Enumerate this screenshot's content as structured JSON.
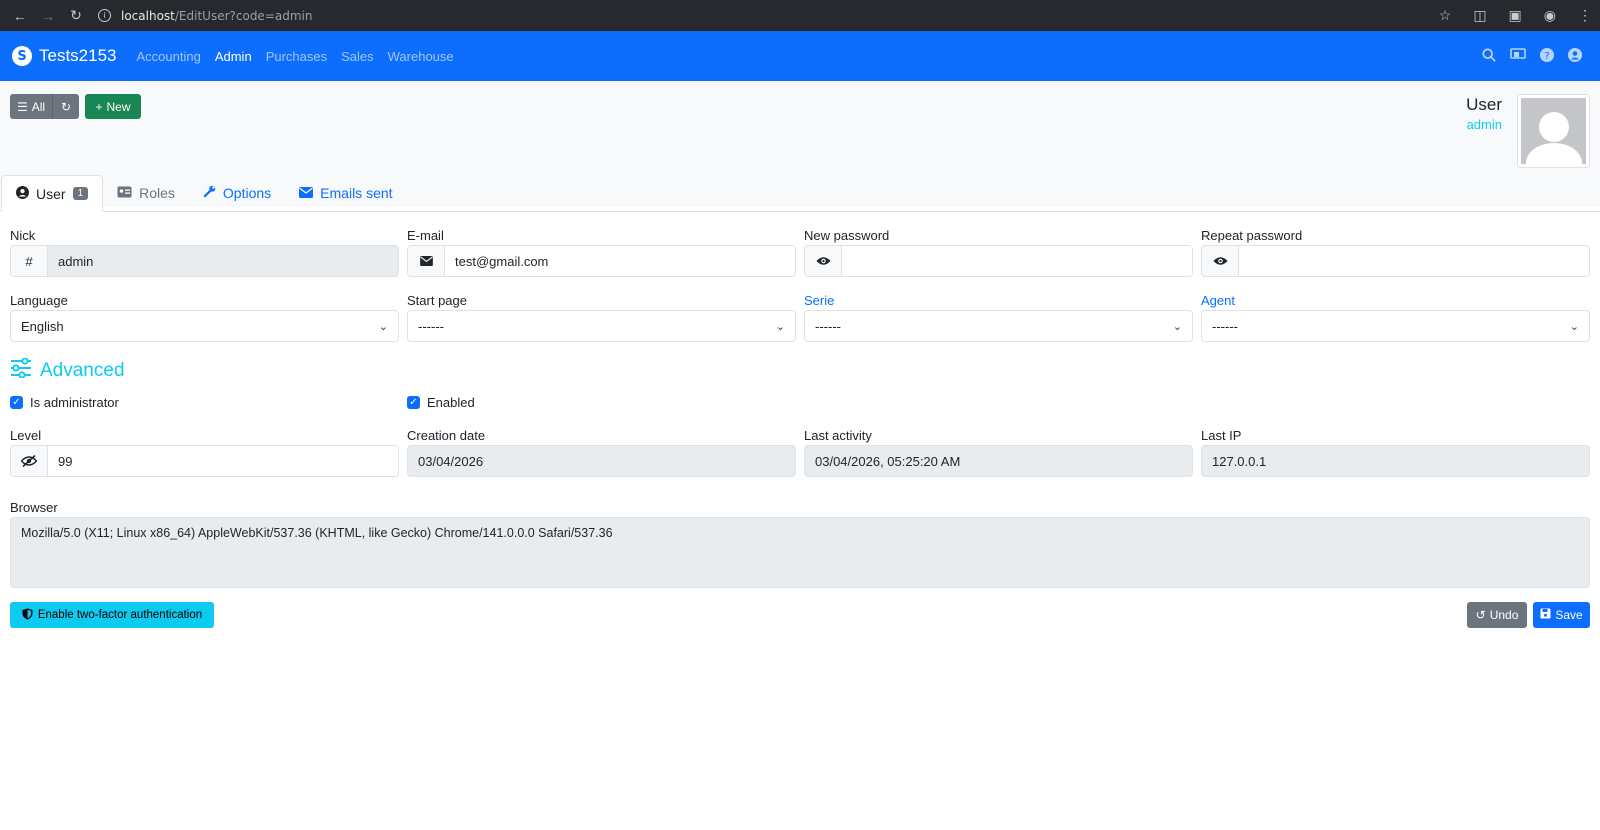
{
  "browser": {
    "url_host": "localhost",
    "url_path": "/EditUser?code=admin"
  },
  "navbar": {
    "brand": "Tests2153",
    "items": [
      {
        "label": "Accounting",
        "active": false
      },
      {
        "label": "Admin",
        "active": true
      },
      {
        "label": "Purchases",
        "active": false
      },
      {
        "label": "Sales",
        "active": false
      },
      {
        "label": "Warehouse",
        "active": false
      }
    ]
  },
  "toolbar": {
    "all_label": "All",
    "new_label": "New"
  },
  "record": {
    "title": "User",
    "subtitle": "admin"
  },
  "tabs": [
    {
      "label": "User",
      "badge": "1"
    },
    {
      "label": "Roles"
    },
    {
      "label": "Options"
    },
    {
      "label": "Emails sent"
    }
  ],
  "form": {
    "nick_label": "Nick",
    "nick_value": "admin",
    "email_label": "E-mail",
    "email_value": "test@gmail.com",
    "new_password_label": "New password",
    "new_password_value": "",
    "repeat_password_label": "Repeat password",
    "repeat_password_value": "",
    "language_label": "Language",
    "language_value": "English",
    "start_page_label": "Start page",
    "start_page_value": "------",
    "serie_label": "Serie",
    "serie_value": "------",
    "agent_label": "Agent",
    "agent_value": "------"
  },
  "advanced": {
    "title": "Advanced",
    "is_admin_label": "Is administrator",
    "is_admin_checked": true,
    "enabled_label": "Enabled",
    "enabled_checked": true,
    "level_label": "Level",
    "level_value": "99",
    "creation_date_label": "Creation date",
    "creation_date_value": "03/04/2026",
    "last_activity_label": "Last activity",
    "last_activity_value": "03/04/2026, 05:25:20 AM",
    "last_ip_label": "Last IP",
    "last_ip_value": "127.0.0.1",
    "browser_label": "Browser",
    "browser_value": "Mozilla/5.0 (X11; Linux x86_64) AppleWebKit/537.36 (KHTML, like Gecko) Chrome/141.0.0.0 Safari/537.36"
  },
  "actions": {
    "two_factor_label": "Enable two-factor authentication",
    "undo_label": "Undo",
    "save_label": "Save"
  },
  "colors": {
    "primary": "#0d6efd",
    "info": "#0dcaf0",
    "success": "#198754",
    "secondary": "#6c757d"
  }
}
